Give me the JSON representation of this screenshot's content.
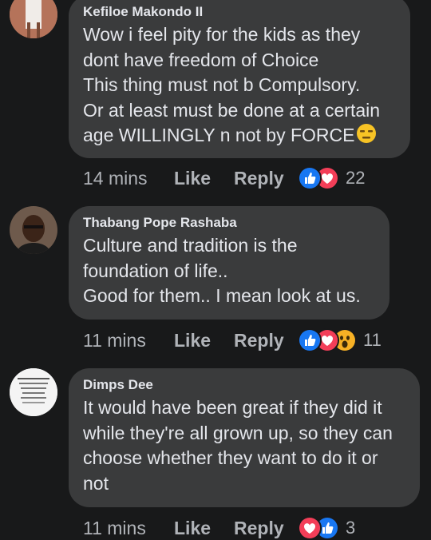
{
  "colors": {
    "background": "#18191a",
    "bubble": "#3a3b3c",
    "text": "#e4e6eb",
    "secondary_text": "#b0b3b8",
    "like_blue": "#1877f2",
    "love_red": "#f33e58",
    "wow_yellow": "#f7b125"
  },
  "comments": [
    {
      "author": "Kefiloe Makondo II",
      "lines": [
        "Wow i feel pity for the kids as they",
        "dont have freedom of Choice",
        "This thing must not b Compulsory.",
        "Or at least must be done at a certain",
        "age WILLINGLY  n not by FORCE"
      ],
      "emoji": "expressionless-face-icon",
      "time": "14 mins",
      "like_label": "Like",
      "reply_label": "Reply",
      "reactions": [
        "like-reaction-icon",
        "love-reaction-icon"
      ],
      "reaction_count": "22"
    },
    {
      "author": "Thabang Pope Rashaba",
      "lines": [
        "Culture and tradition is the",
        "foundation of life..",
        "Good for them.. I mean look at us."
      ],
      "time": "11 mins",
      "like_label": "Like",
      "reply_label": "Reply",
      "reactions": [
        "like-reaction-icon",
        "love-reaction-icon",
        "wow-reaction-icon"
      ],
      "reaction_count": "11"
    },
    {
      "author": "Dimps Dee",
      "lines": [
        "It would have been great if they did it",
        "while they're all grown up, so they can",
        "choose whether they want to do it or",
        "not"
      ],
      "time": "11 mins",
      "like_label": "Like",
      "reply_label": "Reply",
      "reactions": [
        "love-reaction-icon",
        "like-reaction-icon"
      ],
      "reaction_count": "3"
    }
  ]
}
